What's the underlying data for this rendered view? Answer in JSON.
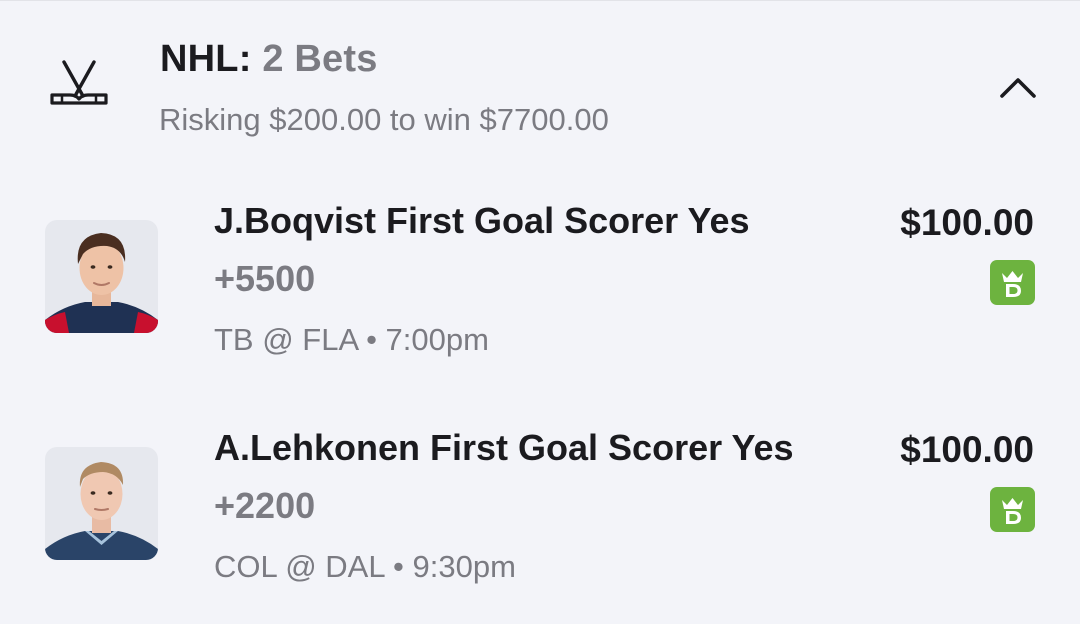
{
  "group": {
    "league": "NHL:",
    "count_label": "2 Bets",
    "summary": "Risking $200.00 to win $7700.00",
    "sport_icon": "hockey-sticks-icon",
    "toggle_icon": "chevron-up-icon"
  },
  "bets": [
    {
      "selection": "J.Boqvist First Goal Scorer Yes",
      "odds": "+5500",
      "game": "TB @ FLA • 7:00pm",
      "stake": "$100.00",
      "book_icon": "draftkings-icon",
      "jersey_color": "#1f3153",
      "jersey_accent": "#c8102e",
      "hair_color": "#4a2e20"
    },
    {
      "selection": "A.Lehkonen First Goal Scorer Yes",
      "odds": "+2200",
      "game": "COL @ DAL • 9:30pm",
      "stake": "$100.00",
      "book_icon": "draftkings-icon",
      "jersey_color": "#2a4468",
      "jersey_accent": "#a7c3dc",
      "hair_color": "#b08a63"
    }
  ],
  "colors": {
    "book_badge": "#6db33f",
    "muted_text": "#7b7b82",
    "background": "#f3f4f9"
  }
}
